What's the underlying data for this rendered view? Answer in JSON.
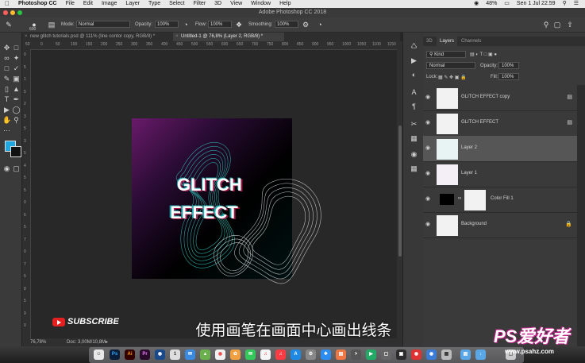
{
  "menubar": {
    "apple": "",
    "items": [
      "Photoshop CC",
      "File",
      "Edit",
      "Image",
      "Layer",
      "Type",
      "Select",
      "Filter",
      "3D",
      "View",
      "Window",
      "Help"
    ],
    "battery": "48%",
    "clock": "Sen 1 Jul  22.59"
  },
  "window": {
    "title": "Adobe Photoshop CC 2018"
  },
  "options": {
    "brush_size": "600",
    "mode_label": "Mode:",
    "mode_value": "Normal",
    "opacity_label": "Opacity:",
    "opacity_value": "100%",
    "flow_label": "Flow:",
    "flow_value": "100%",
    "smoothing_label": "Smoothing:",
    "smoothing_value": "100%"
  },
  "tabs": [
    {
      "label": "new glitch tutorials.psd @ 111% (line contor copy, RGB/8) *"
    },
    {
      "label": "Untitled-1 @ 76,8% (Layer 2, RGB/8) *"
    }
  ],
  "ruler_top": [
    "50",
    "0",
    "50",
    "100",
    "150",
    "200",
    "250",
    "300",
    "350",
    "400",
    "450",
    "500",
    "550",
    "600",
    "650",
    "700",
    "750",
    "800",
    "850",
    "900",
    "950",
    "1000",
    "1050",
    "1100",
    "1150"
  ],
  "ruler_left": [
    "0",
    "5",
    "1",
    "5",
    "2",
    "3",
    "5",
    "3",
    "5",
    "4",
    "5",
    "5",
    "0",
    "6",
    "5",
    "7",
    "0",
    "7",
    "5",
    "8",
    "5",
    "9",
    "0"
  ],
  "artwork": {
    "line1": "GLITCH",
    "line2": "EFFECT"
  },
  "status": {
    "zoom": "76,78%",
    "doc": "Doc: 3,00M/10,8M"
  },
  "panel": {
    "tabs": [
      "3D",
      "Layers",
      "Channels"
    ],
    "active_tab": "Layers",
    "filter_value": "Kind",
    "blend_value": "Normal",
    "opacity_label": "Opacity:",
    "opacity_value": "100%",
    "lock_label": "Lock:",
    "fill_label": "Fill:",
    "fill_value": "100%"
  },
  "layers": [
    {
      "name": "GLITCH EFFECT copy",
      "selected": false
    },
    {
      "name": "GLITCH EFFECT",
      "selected": false
    },
    {
      "name": "Layer 2",
      "selected": true
    },
    {
      "name": "Layer 1",
      "selected": false
    },
    {
      "name": "Color Fill 1",
      "selected": false
    },
    {
      "name": "Background",
      "selected": false
    }
  ],
  "overlay": {
    "subscribe": "SUBSCRIBE",
    "subtitle": "使用画笔在画面中心画出线条"
  },
  "watermark": {
    "brand": "PS爱好者",
    "url": "www.psahz.com"
  },
  "dock": [
    "Ps",
    "Ai",
    "Pr",
    "Ae",
    "Mail",
    "Maps",
    "Photos",
    "Music",
    "Safari",
    "Chrome",
    "Messages",
    "Notes",
    "Store",
    "Prefs",
    "Finder",
    "Folder",
    "Trash"
  ],
  "colors": {
    "foreground": "#1ea7e1",
    "background": "#111111",
    "accent": "#e52020"
  }
}
